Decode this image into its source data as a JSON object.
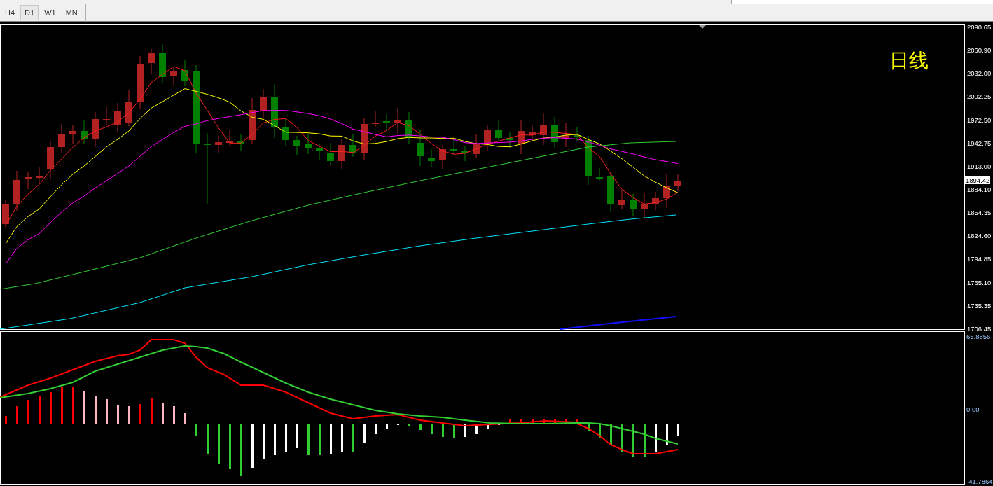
{
  "timeframe_tabs": [
    {
      "label": "H4",
      "selected": false
    },
    {
      "label": "D1",
      "selected": true
    },
    {
      "label": "W1",
      "selected": false
    },
    {
      "label": "MN",
      "selected": false
    }
  ],
  "chart": {
    "overlay_label": "日线",
    "price_axis": [
      "2090.65",
      "2060.90",
      "2032.00",
      "2002.25",
      "1972.50",
      "1942.75",
      "1913.00",
      "1884.10",
      "1854.35",
      "1824.60",
      "1794.85",
      "1765.10",
      "1735.35",
      "1706.45"
    ],
    "current_price": "1894.42"
  },
  "indicator": {
    "axis": [
      "65.8856",
      "0.00",
      "-41.7864"
    ]
  }
}
